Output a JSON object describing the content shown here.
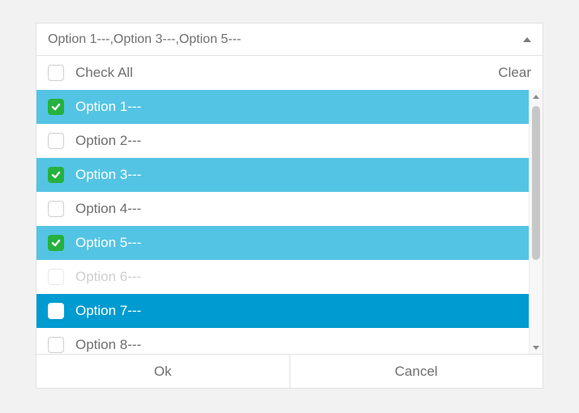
{
  "header": {
    "summary": "Option 1---,Option 3---,Option 5---"
  },
  "controls": {
    "check_all": "Check All",
    "clear": "Clear"
  },
  "options": [
    {
      "label": "Option 1---",
      "state": "selected",
      "checked": true
    },
    {
      "label": "Option 2---",
      "state": "normal",
      "checked": false
    },
    {
      "label": "Option 3---",
      "state": "selected",
      "checked": true
    },
    {
      "label": "Option 4---",
      "state": "normal",
      "checked": false
    },
    {
      "label": "Option 5---",
      "state": "selected",
      "checked": true
    },
    {
      "label": "Option 6---",
      "state": "disabled",
      "checked": false
    },
    {
      "label": "Option 7---",
      "state": "highlight",
      "checked": false
    },
    {
      "label": "Option 8---",
      "state": "normal",
      "checked": false
    }
  ],
  "footer": {
    "ok": "Ok",
    "cancel": "Cancel"
  },
  "colors": {
    "selected_bg": "#54c4e4",
    "highlight_bg": "#009bd0",
    "check_green": "#26b13f"
  }
}
